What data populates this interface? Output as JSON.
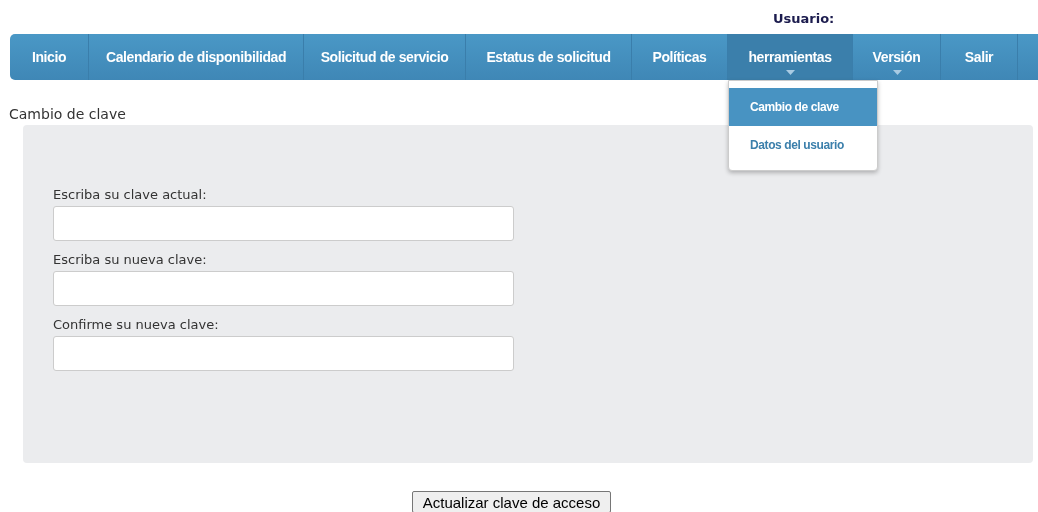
{
  "user_label": "Usuario:",
  "nav": [
    {
      "label": "Inicio",
      "selected": false,
      "has_menu": false
    },
    {
      "label": "Calendario de disponibilidad",
      "selected": false,
      "has_menu": false
    },
    {
      "label": "Solicitud de servicio",
      "selected": false,
      "has_menu": false
    },
    {
      "label": "Estatus de solicitud",
      "selected": false,
      "has_menu": false
    },
    {
      "label": "Políticas",
      "selected": false,
      "has_menu": false
    },
    {
      "label": "herramientas",
      "selected": true,
      "has_menu": true,
      "menu": [
        {
          "label": "Cambio de clave",
          "selected": true
        },
        {
          "label": "Datos del usuario",
          "selected": false
        }
      ]
    },
    {
      "label": "Versión",
      "selected": false,
      "has_menu": true
    },
    {
      "label": "Salir",
      "selected": false,
      "has_menu": false
    }
  ],
  "page_title": "Cambio de clave",
  "fields": [
    {
      "label": "Escriba su clave actual:"
    },
    {
      "label": "Escriba su nueva clave:"
    },
    {
      "label": "Confirme su nueva clave:"
    }
  ],
  "submit_button": "Actualizar clave de acceso"
}
